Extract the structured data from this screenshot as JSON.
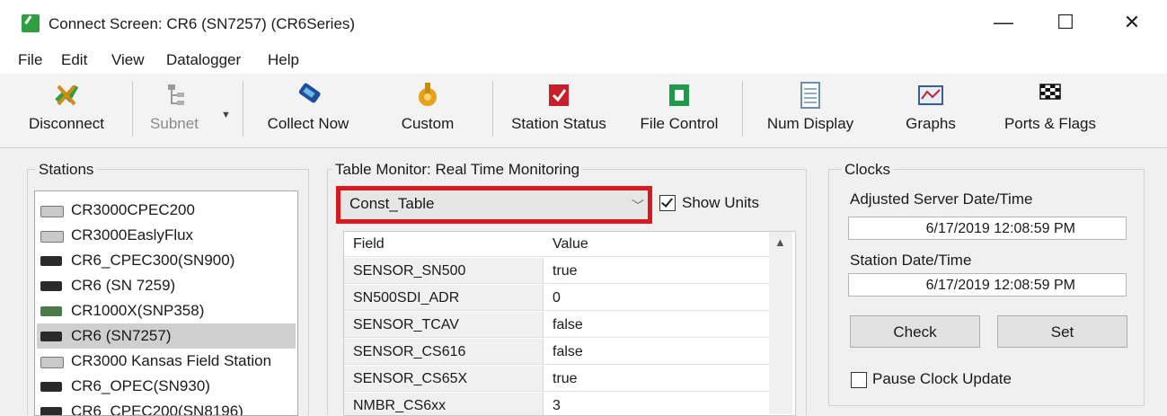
{
  "window": {
    "title": "Connect Screen: CR6 (SN7257) (CR6Series)",
    "minimize": "—",
    "maximize": "☐",
    "close": "✕"
  },
  "menu": [
    "File",
    "Edit",
    "View",
    "Datalogger",
    "Help"
  ],
  "toolbar": {
    "disconnect": "Disconnect",
    "subnet": "Subnet",
    "collect_now": "Collect Now",
    "custom": "Custom",
    "station_status": "Station Status",
    "file_control": "File Control",
    "num_display": "Num Display",
    "graphs": "Graphs",
    "ports_flags": "Ports & Flags"
  },
  "stations": {
    "title": "Stations",
    "selected_index": 5,
    "items": [
      {
        "label": "CR3000CPEC200",
        "icon": "station-cr3000-icon"
      },
      {
        "label": "CR3000EaslyFlux",
        "icon": "station-cr3000-icon"
      },
      {
        "label": "CR6_CPEC300(SN900)",
        "icon": "station-cr6-icon"
      },
      {
        "label": "CR6 (SN 7259)",
        "icon": "station-cr6-icon"
      },
      {
        "label": "CR1000X(SNP358)",
        "icon": "station-cr1000x-icon"
      },
      {
        "label": "CR6 (SN7257)",
        "icon": "station-cr6-icon"
      },
      {
        "label": "CR3000 Kansas Field Station",
        "icon": "station-cr3000-icon"
      },
      {
        "label": "CR6_OPEC(SN930)",
        "icon": "station-cr6-icon"
      },
      {
        "label": "CR6_CPEC200(SN8196)",
        "icon": "station-cr6-icon"
      }
    ]
  },
  "table_monitor": {
    "title": "Table Monitor: Real Time Monitoring",
    "selected_table": "Const_Table",
    "show_units_label": "Show Units",
    "show_units_checked": true,
    "columns": [
      "Field",
      "Value"
    ],
    "rows": [
      {
        "field": "SENSOR_SN500",
        "value": "true"
      },
      {
        "field": "SN500SDI_ADR",
        "value": "0"
      },
      {
        "field": "SENSOR_TCAV",
        "value": "false"
      },
      {
        "field": "SENSOR_CS616",
        "value": "false"
      },
      {
        "field": "SENSOR_CS65X",
        "value": "true"
      },
      {
        "field": "NMBR_CS6xx",
        "value": "3"
      }
    ]
  },
  "clocks": {
    "title": "Clocks",
    "adjusted_server_label": "Adjusted Server Date/Time",
    "adjusted_server_value": "6/17/2019 12:08:59 PM",
    "station_label": "Station Date/Time",
    "station_value": "6/17/2019 12:08:59 PM",
    "check": "Check",
    "set": "Set",
    "pause_label": "Pause Clock Update",
    "pause_checked": false
  },
  "colors": {
    "highlight_border": "#d71920",
    "selected_row": "#cfcfcf",
    "app_icon": "#2e9e3e"
  }
}
